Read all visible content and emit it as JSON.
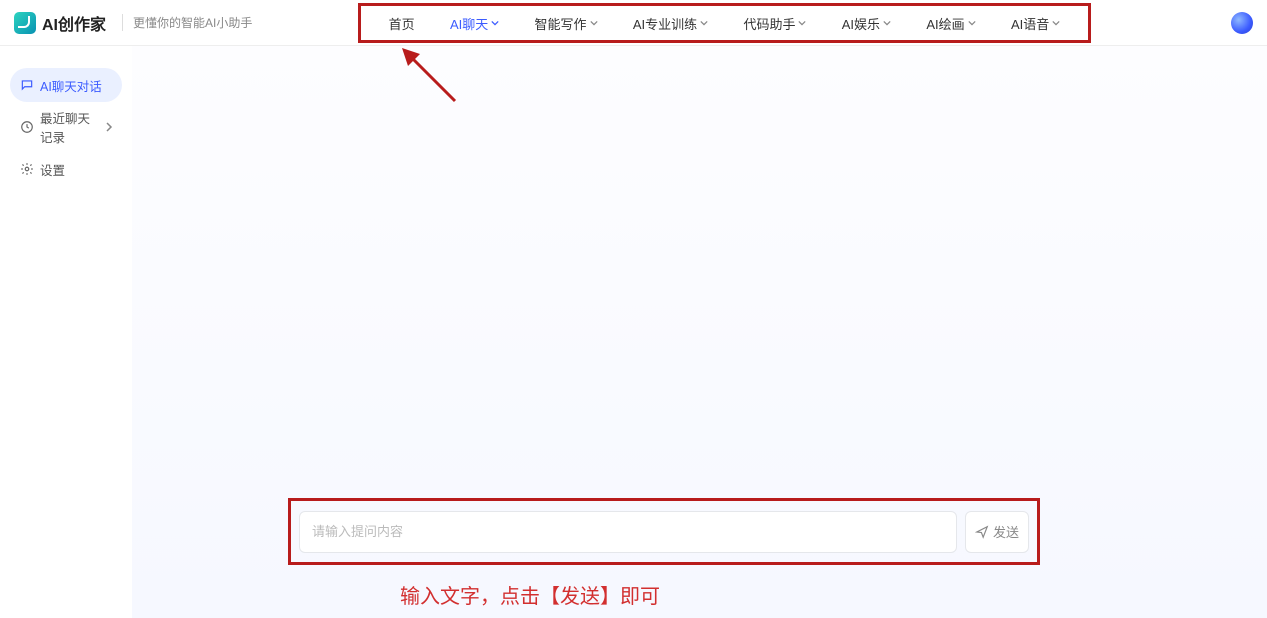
{
  "header": {
    "app_name": "AI创作家",
    "tagline": "更懂你的智能AI小助手",
    "nav": [
      {
        "label": "首页",
        "dropdown": false,
        "active": false
      },
      {
        "label": "AI聊天",
        "dropdown": true,
        "active": true
      },
      {
        "label": "智能写作",
        "dropdown": true,
        "active": false
      },
      {
        "label": "AI专业训练",
        "dropdown": true,
        "active": false
      },
      {
        "label": "代码助手",
        "dropdown": true,
        "active": false
      },
      {
        "label": "AI娱乐",
        "dropdown": true,
        "active": false
      },
      {
        "label": "AI绘画",
        "dropdown": true,
        "active": false
      },
      {
        "label": "AI语音",
        "dropdown": true,
        "active": false
      }
    ]
  },
  "sidebar": {
    "items": [
      {
        "label": "AI聊天对话",
        "icon": "chat-icon",
        "active": true,
        "expandable": false
      },
      {
        "label": "最近聊天记录",
        "icon": "clock-icon",
        "active": false,
        "expandable": true
      },
      {
        "label": "设置",
        "icon": "gear-icon",
        "active": false,
        "expandable": false
      }
    ]
  },
  "chat": {
    "input_placeholder": "请输入提问内容",
    "send_label": "发送"
  },
  "annotation": {
    "caption": "输入文字，点击【发送】即可",
    "highlight_color": "#b81c1c"
  }
}
